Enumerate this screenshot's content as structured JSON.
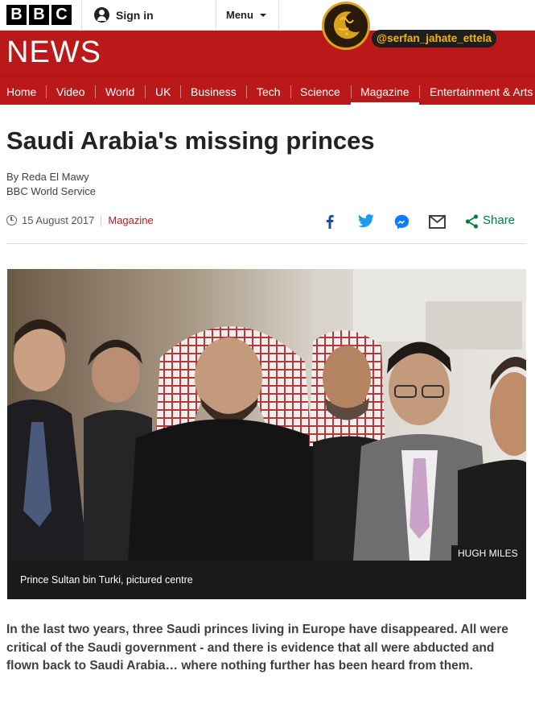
{
  "header": {
    "logo_letters": [
      "B",
      "B",
      "C"
    ],
    "signin_label": "Sign in",
    "menu_label": "Menu",
    "section_title": "NEWS",
    "watermark_handle": "@serfan_jahate_ettela"
  },
  "nav": {
    "items": [
      "Home",
      "Video",
      "World",
      "UK",
      "Business",
      "Tech",
      "Science",
      "Magazine",
      "Entertainment & Arts"
    ],
    "active": "Magazine"
  },
  "article": {
    "headline": "Saudi Arabia's missing princes",
    "author": "By Reda El Mawy",
    "organisation": "BBC World Service",
    "date": "15 August 2017",
    "section_link": "Magazine",
    "share_label": "Share",
    "share_icons": [
      "facebook-icon",
      "twitter-icon",
      "messenger-icon",
      "email-icon",
      "share-icon"
    ],
    "image_credit": "HUGH MILES",
    "image_caption": "Prince Sultan bin Turki, pictured centre",
    "intro": "In the last two years, three Saudi princes living in Europe have disappeared. All were critical of the Saudi government - and there is evidence that all were abducted and flown back to Saudi Arabia… where nothing further has been heard from them."
  },
  "colors": {
    "brand_red": "#bb1919",
    "share_blue": "#1d4e9b",
    "twitter_blue": "#1da1f2",
    "share_green": "#007f3c",
    "watermark_gold": "#f5b400"
  }
}
